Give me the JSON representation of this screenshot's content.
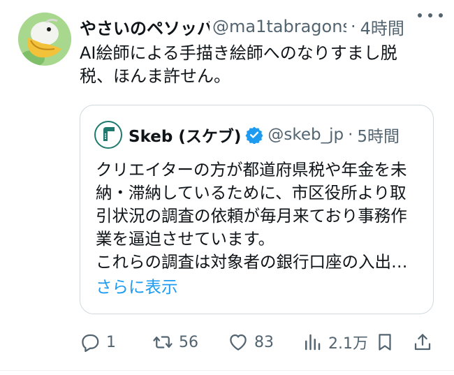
{
  "tweet": {
    "display_name": "やさいのペソッバ",
    "handle": "@ma1tabragons",
    "separator": "·",
    "time": "4時間",
    "text_line1": "AI絵師による手描き絵師へのなりすまし脱",
    "text_line2": "税、ほんま許せん。"
  },
  "quote": {
    "display_name": "Skeb (スケブ)",
    "handle": "@skeb_jp",
    "separator": "·",
    "time": "5時間",
    "line1": "クリエイターの方が都道府県税や年金を未",
    "line2": "納・滞納しているために、市区役所より取",
    "line3": "引状況の調査の依頼が毎月来ており事務作",
    "line4": "業を逼迫させています。",
    "line5": "これらの調査は対象者の銀行口座の入出…",
    "show_more": "さらに表示"
  },
  "actions": {
    "replies": "1",
    "retweets": "56",
    "likes": "83",
    "views": "2.1万"
  },
  "icons": [
    "pelican-avatar",
    "skeb-avatar",
    "verified-badge-icon",
    "more-icon",
    "reply-icon",
    "retweet-icon",
    "like-icon",
    "views-icon",
    "bookmark-icon",
    "share-icon"
  ],
  "colors": {
    "accent": "#1d9bf0",
    "secondary_text": "#536471",
    "border": "#cfd9de"
  }
}
